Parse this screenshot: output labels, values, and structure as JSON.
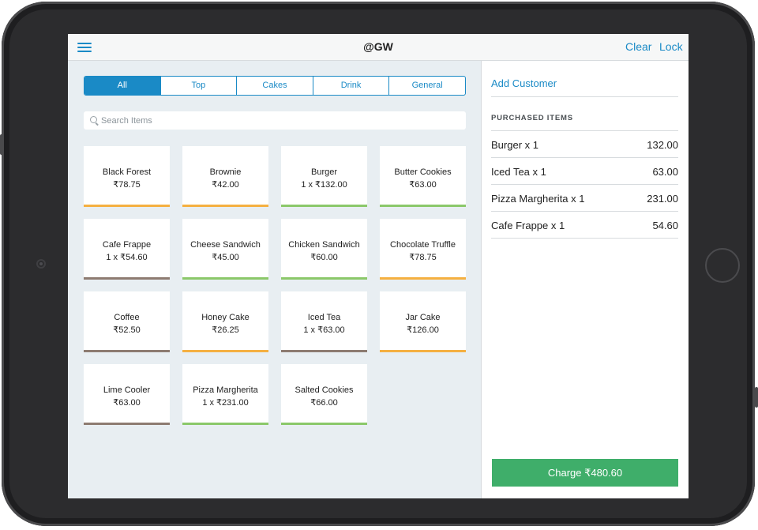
{
  "topbar": {
    "title": "@GW",
    "clear_label": "Clear",
    "lock_label": "Lock"
  },
  "tabs": [
    {
      "label": "All",
      "active": true
    },
    {
      "label": "Top",
      "active": false
    },
    {
      "label": "Cakes",
      "active": false
    },
    {
      "label": "Drink",
      "active": false
    },
    {
      "label": "General",
      "active": false
    }
  ],
  "search": {
    "placeholder": "Search Items",
    "value": ""
  },
  "items": [
    {
      "name": "Black Forest",
      "price": "₹78.75",
      "bar_color": "#f5b041"
    },
    {
      "name": "Brownie",
      "price": "₹42.00",
      "bar_color": "#f5b041"
    },
    {
      "name": "Burger",
      "price": "1 x  ₹132.00",
      "bar_color": "#8bc86a"
    },
    {
      "name": "Butter Cookies",
      "price": "₹63.00",
      "bar_color": "#8bc86a"
    },
    {
      "name": "Cafe Frappe",
      "price": "1 x  ₹54.60",
      "bar_color": "#8d7b71"
    },
    {
      "name": "Cheese Sandwich",
      "price": "₹45.00",
      "bar_color": "#8bc86a"
    },
    {
      "name": "Chicken Sandwich",
      "price": "₹60.00",
      "bar_color": "#8bc86a"
    },
    {
      "name": "Chocolate Truffle",
      "price": "₹78.75",
      "bar_color": "#f5b041"
    },
    {
      "name": "Coffee",
      "price": "₹52.50",
      "bar_color": "#8d7b71"
    },
    {
      "name": "Honey Cake",
      "price": "₹26.25",
      "bar_color": "#f5b041"
    },
    {
      "name": "Iced Tea",
      "price": "1 x  ₹63.00",
      "bar_color": "#8d7b71"
    },
    {
      "name": "Jar Cake",
      "price": "₹126.00",
      "bar_color": "#f5b041"
    },
    {
      "name": "Lime Cooler",
      "price": "₹63.00",
      "bar_color": "#8d7b71"
    },
    {
      "name": "Pizza Margherita",
      "price": "1 x  ₹231.00",
      "bar_color": "#8bc86a"
    },
    {
      "name": "Salted Cookies",
      "price": "₹66.00",
      "bar_color": "#8bc86a"
    }
  ],
  "cart": {
    "add_customer_label": "Add Customer",
    "section_label": "PURCHASED ITEMS",
    "lines": [
      {
        "name": "Burger x 1",
        "amount": "132.00"
      },
      {
        "name": "Iced Tea x 1",
        "amount": "63.00"
      },
      {
        "name": "Pizza Margherita x 1",
        "amount": "231.00"
      },
      {
        "name": "Cafe Frappe x 1",
        "amount": "54.60"
      }
    ],
    "charge_label": "Charge ₹480.60"
  },
  "icons": {
    "menu": "hamburger-menu-icon",
    "search": "search-icon"
  },
  "colors": {
    "accent": "#1a8ac6",
    "charge": "#3fae6a"
  }
}
